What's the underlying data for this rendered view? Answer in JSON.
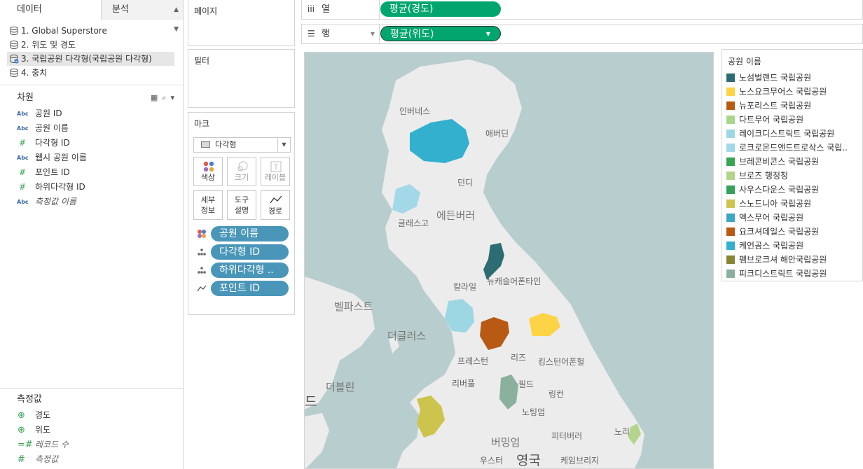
{
  "left_pane": {
    "tabs": [
      {
        "label": "데이터"
      },
      {
        "label": "분석"
      }
    ],
    "datasources": [
      {
        "label": "1. Global Superstore"
      },
      {
        "label": "2. 위도 및 경도"
      },
      {
        "label": "3. 국립공원 다각형(국립공원 다각형)"
      },
      {
        "label": "4. 충치"
      }
    ],
    "dimensions_title": "차원",
    "dimension_type_abc": "Abc",
    "dimension_type_hash": "#",
    "dimensions": [
      {
        "name": "공원 ID"
      },
      {
        "name": "공원 이름"
      },
      {
        "name": "다각형 ID"
      },
      {
        "name": "웹시 공원 이름"
      },
      {
        "name": "포인트 ID"
      },
      {
        "name": "하위다각형 ID"
      },
      {
        "name": "측정값 이름"
      }
    ],
    "measures_title": "측정값",
    "measures": [
      {
        "name": "경도"
      },
      {
        "name": "위도"
      },
      {
        "name": "레코드 수"
      },
      {
        "name": "측정값"
      }
    ]
  },
  "cards": {
    "pages_title": "페이지",
    "filters_title": "필터",
    "marks_title": "마크",
    "mark_type": "다각형",
    "buttons": {
      "color": "색상",
      "size": "크기",
      "label": "레이블",
      "detail": "세부\n정보",
      "tooltip": "도구\n설명",
      "path": "경로"
    },
    "mark_pills": [
      {
        "label": "공원 이름"
      },
      {
        "label": "다각형 ID"
      },
      {
        "label": "하위다각형 .."
      },
      {
        "label": "포인트 ID"
      }
    ]
  },
  "shelves": {
    "columns_label": "열",
    "columns_pill": "평균(경도)",
    "rows_label": "행",
    "rows_pill": "평균(위도)"
  },
  "map": {
    "labels": {
      "inverness": "인버네스",
      "aberdeen": "애버딘",
      "dundee": "던디",
      "edinburgh": "에든버러",
      "glasgow": "글래스고",
      "carlisle": "칼라일",
      "newcastle": "뉴캐슬어폰타인",
      "belfast": "벨파스트",
      "douglas": "더글러스",
      "preston": "프레스턴",
      "leeds": "리즈",
      "hull": "킹스턴어폰헐",
      "liverpool": "리버풀",
      "sheffield": "필드",
      "lincoln": "링컨",
      "dublin": "더블린",
      "nottingham": "노팅엄",
      "birmingham": "버밍엄",
      "peterborough": "피터버러",
      "worcester": "우스터",
      "england": "영국",
      "cambridge": "케임브리지",
      "norwich": "노리",
      "ireland_edge": "드"
    },
    "colors": {
      "water": "#b8cdcd",
      "land": "#ececec"
    }
  },
  "legend": {
    "title": "공원 이름",
    "items": [
      {
        "name": "노섬벌랜드 국립공원",
        "color": "#2e6c73"
      },
      {
        "name": "노스요크무어스 국립공원",
        "color": "#fdd445"
      },
      {
        "name": "뉴포리스트 국립공원",
        "color": "#b85b10"
      },
      {
        "name": "다트무어 국립공원",
        "color": "#a7d78c"
      },
      {
        "name": "레이크디스트릭트 국립공원",
        "color": "#9ed7e4"
      },
      {
        "name": "로크로몬드앤드트로삭스 국립..",
        "color": "#a3d8e8"
      },
      {
        "name": "브레콘비콘스 국립공원",
        "color": "#37a454"
      },
      {
        "name": "브로즈 행정청",
        "color": "#b2d58b"
      },
      {
        "name": "사우스다운스 국립공원",
        "color": "#35a05a"
      },
      {
        "name": "스노드니아 국립공원",
        "color": "#ccc44d"
      },
      {
        "name": "엑스무어 국립공원",
        "color": "#3aa8c2"
      },
      {
        "name": "요크셔데일스 국립공원",
        "color": "#b85a13"
      },
      {
        "name": "케언곰스 국립공원",
        "color": "#33b0ce"
      },
      {
        "name": "펨브로크셔 해안국립공원",
        "color": "#868536"
      },
      {
        "name": "피크디스트릭트 국립공원",
        "color": "#8cb09e"
      }
    ]
  }
}
